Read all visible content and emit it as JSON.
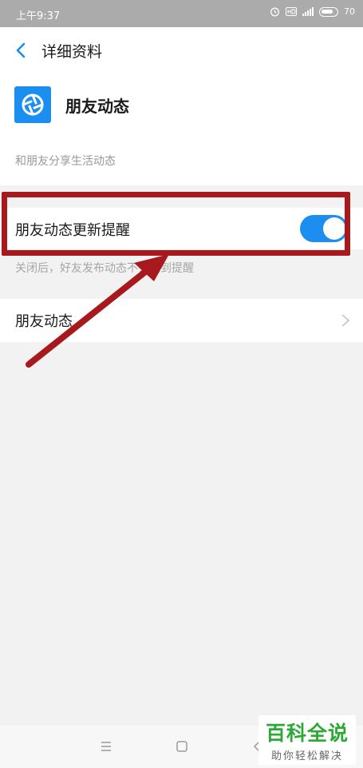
{
  "status_bar": {
    "time": "上午9:37",
    "battery": "70"
  },
  "header": {
    "title": "详细资料"
  },
  "app": {
    "name": "朋友动态",
    "description": "和朋友分享生活动态",
    "icon": "shutter-icon",
    "icon_color": "#1b8ef0"
  },
  "settings": {
    "update_reminder": {
      "label": "朋友动态更新提醒",
      "enabled": true,
      "note": "关闭后，好友发布动态不会收到提醒"
    },
    "moments_entry": {
      "label": "朋友动态"
    }
  },
  "annotation": {
    "highlight_color": "#a8191e"
  },
  "watermark": {
    "main": "百科全说",
    "sub": "助你轻松解决"
  }
}
